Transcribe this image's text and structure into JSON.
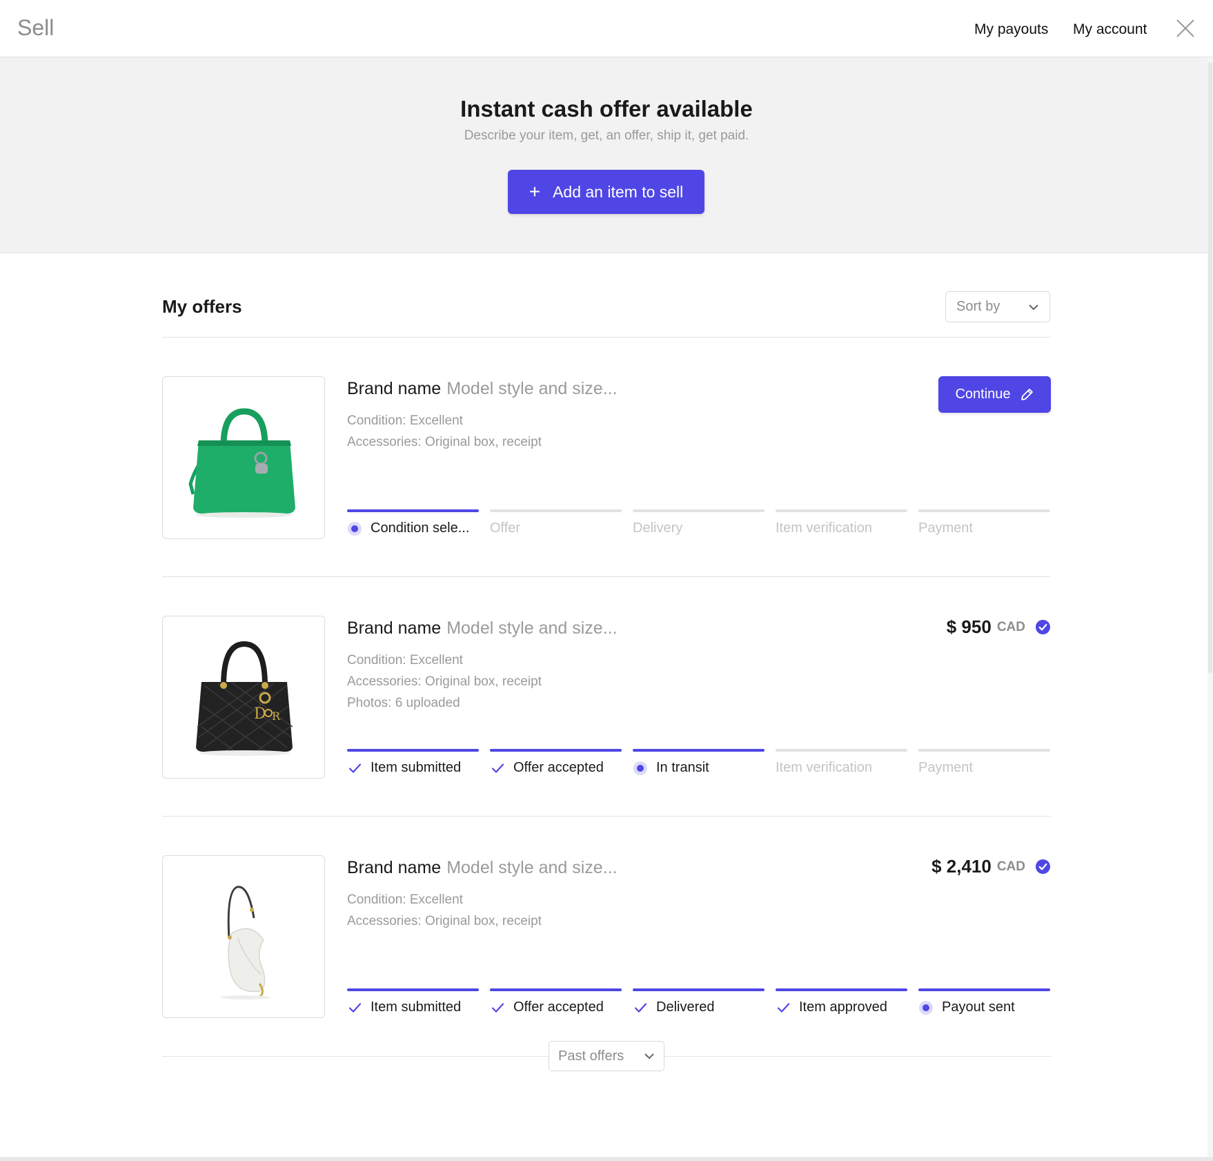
{
  "header": {
    "title": "Sell",
    "nav": {
      "payouts": "My payouts",
      "account": "My account"
    },
    "close_icon": "close-icon"
  },
  "hero": {
    "title": "Instant cash offer available",
    "subtitle": "Describe your item, get, an offer, ship it, get paid.",
    "button_label": "Add an item to sell",
    "button_icon": "plus-icon"
  },
  "offers_section": {
    "title": "My offers",
    "sort_label": "Sort by",
    "past_label": "Past offers"
  },
  "colors": {
    "accent": "#4f46e5",
    "muted_text": "#9a9a9a",
    "pending_text": "#c4c4c4",
    "hero_bg": "#f2f2f2"
  },
  "offers": [
    {
      "brand": "Brand name",
      "model": "Model style and size...",
      "image": "green-handbag",
      "details": [
        "Condition: Excellent",
        "Accessories: Original box, receipt"
      ],
      "action_label": "Continue",
      "action_icon": "pencil-icon",
      "steps": [
        {
          "label": "Condition sele...",
          "state": "current"
        },
        {
          "label": "Offer",
          "state": "pending"
        },
        {
          "label": "Delivery",
          "state": "pending"
        },
        {
          "label": "Item verification",
          "state": "pending"
        },
        {
          "label": "Payment",
          "state": "pending"
        }
      ]
    },
    {
      "brand": "Brand name",
      "model": "Model style and size...",
      "image": "black-quilted-handbag",
      "details": [
        "Condition: Excellent",
        "Accessories: Original box, receipt",
        "Photos: 6 uploaded"
      ],
      "price": "$ 950",
      "currency": "CAD",
      "verified_icon": "check-circle-icon",
      "steps": [
        {
          "label": "Item submitted",
          "state": "done"
        },
        {
          "label": "Offer accepted",
          "state": "done"
        },
        {
          "label": "In transit",
          "state": "current"
        },
        {
          "label": "Item verification",
          "state": "pending"
        },
        {
          "label": "Payment",
          "state": "pending"
        }
      ]
    },
    {
      "brand": "Brand name",
      "model": "Model style and size...",
      "image": "white-saddle-bag",
      "details": [
        "Condition: Excellent",
        "Accessories: Original box, receipt"
      ],
      "price": "$ 2,410",
      "currency": "CAD",
      "verified_icon": "check-circle-icon",
      "steps": [
        {
          "label": "Item submitted",
          "state": "done"
        },
        {
          "label": "Offer accepted",
          "state": "done"
        },
        {
          "label": "Delivered",
          "state": "done"
        },
        {
          "label": "Item approved",
          "state": "done"
        },
        {
          "label": "Payout sent",
          "state": "current"
        }
      ]
    }
  ]
}
